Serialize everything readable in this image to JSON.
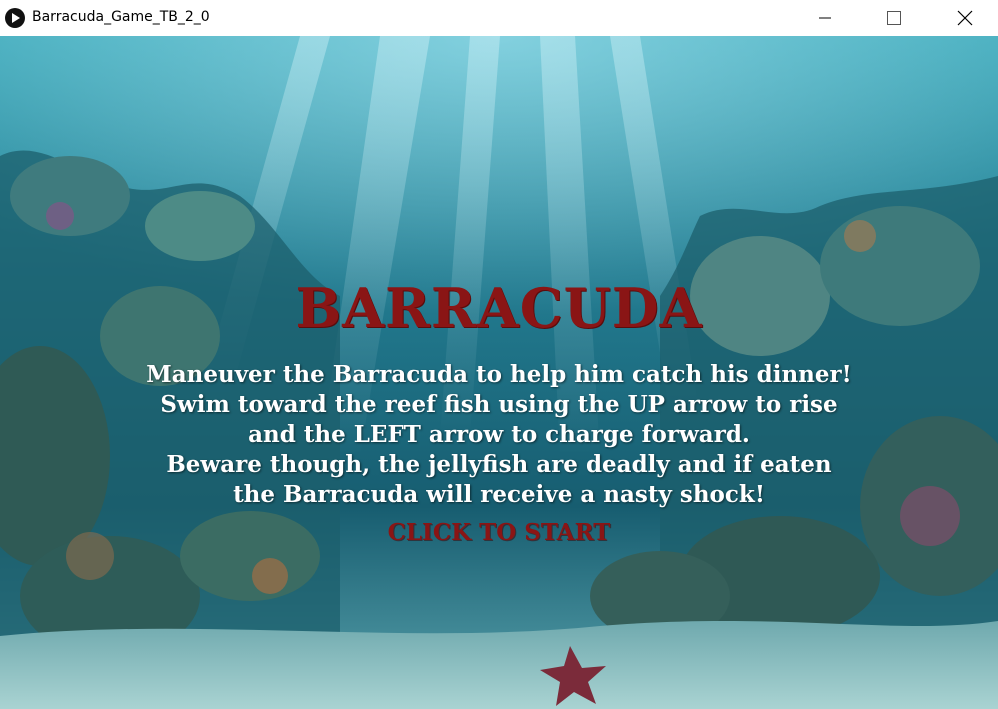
{
  "window": {
    "title": "Barracuda_Game_TB_2_0",
    "app_icon": "play-icon",
    "controls": [
      "minimize-icon",
      "maximize-icon",
      "close-icon"
    ]
  },
  "game": {
    "title": "BARRACUDA",
    "instructions": [
      "Maneuver the Barracuda to help him catch his dinner!",
      "Swim toward the reef fish using the UP arrow to rise",
      "and the LEFT arrow to charge forward.",
      "Beware though, the jellyfish are deadly and if eaten",
      "the Barracuda will receive a nasty shock!"
    ],
    "start_label": "CLICK TO START"
  },
  "colors": {
    "title_red": "#8a1515",
    "instruction_text": "#ffffff",
    "water_top": "#2f8fa3",
    "water_bottom": "#0e4a5c"
  }
}
